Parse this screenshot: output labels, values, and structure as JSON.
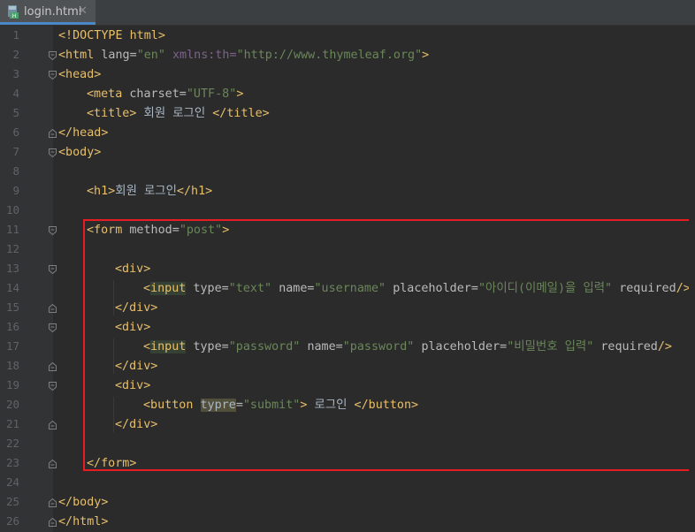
{
  "tab": {
    "filename": "login.html",
    "close_glyph": "✕"
  },
  "colors": {
    "tag": "#e8bf6a",
    "attr": "#bababa",
    "value": "#6a8759",
    "text": "#a9b7c6",
    "highlight_box": "#e81c23"
  },
  "lines": [
    {
      "n": "1",
      "segs": [
        {
          "c": "tag",
          "t": "<!DOCTYPE html>"
        }
      ]
    },
    {
      "n": "2",
      "fold": "open",
      "segs": [
        {
          "c": "tag",
          "t": "<html "
        },
        {
          "c": "attr",
          "t": "lang="
        },
        {
          "c": "val",
          "t": "\"en\""
        },
        {
          "c": "txt",
          "t": " "
        },
        {
          "c": "attrdim",
          "t": "xmlns:th="
        },
        {
          "c": "val",
          "t": "\"http://www.thymeleaf.org\""
        },
        {
          "c": "tag",
          "t": ">"
        }
      ]
    },
    {
      "n": "3",
      "fold": "open",
      "segs": [
        {
          "c": "tag",
          "t": "<head>"
        }
      ]
    },
    {
      "n": "4",
      "indent": 1,
      "segs": [
        {
          "c": "tag",
          "t": "<meta "
        },
        {
          "c": "attr",
          "t": "charset="
        },
        {
          "c": "val",
          "t": "\"UTF-8\""
        },
        {
          "c": "tag",
          "t": ">"
        }
      ]
    },
    {
      "n": "5",
      "indent": 1,
      "segs": [
        {
          "c": "tag",
          "t": "<title>"
        },
        {
          "c": "txt",
          "t": " 회원 로그인 "
        },
        {
          "c": "tag",
          "t": "</title>"
        }
      ]
    },
    {
      "n": "6",
      "fold": "close",
      "segs": [
        {
          "c": "tag",
          "t": "</head>"
        }
      ]
    },
    {
      "n": "7",
      "fold": "open",
      "segs": [
        {
          "c": "tag",
          "t": "<body>"
        }
      ]
    },
    {
      "n": "8",
      "segs": []
    },
    {
      "n": "9",
      "indent": 1,
      "segs": [
        {
          "c": "tag",
          "t": "<h1>"
        },
        {
          "c": "txt",
          "t": "회원 로그인"
        },
        {
          "c": "tag",
          "t": "</h1>"
        }
      ]
    },
    {
      "n": "10",
      "segs": []
    },
    {
      "n": "11",
      "indent": 1,
      "fold": "open",
      "segs": [
        {
          "c": "tag",
          "t": "<form "
        },
        {
          "c": "attr",
          "t": "method="
        },
        {
          "c": "val",
          "t": "\"post\""
        },
        {
          "c": "tag",
          "t": ">"
        }
      ]
    },
    {
      "n": "12",
      "segs": []
    },
    {
      "n": "13",
      "indent": 2,
      "fold": "open",
      "segs": [
        {
          "c": "tag",
          "t": "<div>"
        }
      ]
    },
    {
      "n": "14",
      "indent": 3,
      "segs": [
        {
          "c": "tag",
          "t": "<"
        },
        {
          "c": "hl",
          "t": "input"
        },
        {
          "c": "tag",
          "t": " "
        },
        {
          "c": "attr",
          "t": "type="
        },
        {
          "c": "val",
          "t": "\"text\""
        },
        {
          "c": "txt",
          "t": " "
        },
        {
          "c": "attr",
          "t": "name="
        },
        {
          "c": "val",
          "t": "\"username\""
        },
        {
          "c": "txt",
          "t": " "
        },
        {
          "c": "attr",
          "t": "placeholder="
        },
        {
          "c": "val",
          "t": "\"아이디(이메일)을 입력\""
        },
        {
          "c": "txt",
          "t": " "
        },
        {
          "c": "attr",
          "t": "required"
        },
        {
          "c": "tag",
          "t": "/>"
        }
      ]
    },
    {
      "n": "15",
      "indent": 2,
      "fold": "close",
      "segs": [
        {
          "c": "tag",
          "t": "</div>"
        }
      ]
    },
    {
      "n": "16",
      "indent": 2,
      "fold": "open",
      "segs": [
        {
          "c": "tag",
          "t": "<div>"
        }
      ]
    },
    {
      "n": "17",
      "indent": 3,
      "segs": [
        {
          "c": "tag",
          "t": "<"
        },
        {
          "c": "hl",
          "t": "input"
        },
        {
          "c": "tag",
          "t": " "
        },
        {
          "c": "attr",
          "t": "type="
        },
        {
          "c": "val",
          "t": "\"password\""
        },
        {
          "c": "txt",
          "t": " "
        },
        {
          "c": "attr",
          "t": "name="
        },
        {
          "c": "val",
          "t": "\"password\""
        },
        {
          "c": "txt",
          "t": " "
        },
        {
          "c": "attr",
          "t": "placeholder="
        },
        {
          "c": "val",
          "t": "\"비밀번호 입력\""
        },
        {
          "c": "txt",
          "t": " "
        },
        {
          "c": "attr",
          "t": "required"
        },
        {
          "c": "tag",
          "t": "/>"
        }
      ]
    },
    {
      "n": "18",
      "indent": 2,
      "fold": "close",
      "segs": [
        {
          "c": "tag",
          "t": "</div>"
        }
      ]
    },
    {
      "n": "19",
      "indent": 2,
      "fold": "open",
      "segs": [
        {
          "c": "tag",
          "t": "<div>"
        }
      ]
    },
    {
      "n": "20",
      "indent": 3,
      "segs": [
        {
          "c": "tag",
          "t": "<button "
        },
        {
          "c": "hlb",
          "t": "typre"
        },
        {
          "c": "attr",
          "t": "="
        },
        {
          "c": "val",
          "t": "\"submit\""
        },
        {
          "c": "tag",
          "t": ">"
        },
        {
          "c": "txt",
          "t": " 로그인 "
        },
        {
          "c": "tag",
          "t": "</button>"
        }
      ]
    },
    {
      "n": "21",
      "indent": 2,
      "fold": "close",
      "segs": [
        {
          "c": "tag",
          "t": "</div>"
        }
      ]
    },
    {
      "n": "22",
      "segs": []
    },
    {
      "n": "23",
      "indent": 1,
      "fold": "close",
      "segs": [
        {
          "c": "tag",
          "t": "</form>"
        }
      ]
    },
    {
      "n": "24",
      "segs": []
    },
    {
      "n": "25",
      "fold": "close",
      "segs": [
        {
          "c": "tag",
          "t": "</body>"
        }
      ]
    },
    {
      "n": "26",
      "fold": "close",
      "segs": [
        {
          "c": "tag",
          "t": "</html>"
        }
      ]
    }
  ]
}
